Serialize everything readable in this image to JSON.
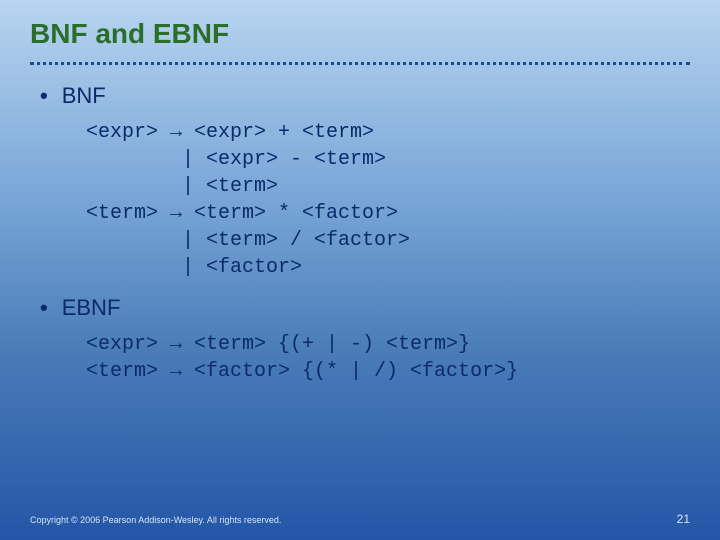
{
  "title": "BNF and EBNF",
  "bullets": {
    "bnf": "BNF",
    "ebnf": "EBNF"
  },
  "bnf_code": "<expr> → <expr> + <term>\n        | <expr> - <term>\n        | <term>\n<term> → <term> * <factor>\n        | <term> / <factor>\n        | <factor>",
  "ebnf_code": "<expr> → <term> {(+ | -) <term>}\n<term> → <factor> {(* | /) <factor>}",
  "footer": {
    "copyright": "Copyright © 2006 Pearson Addison-Wesley. All rights reserved.",
    "page": "21"
  }
}
